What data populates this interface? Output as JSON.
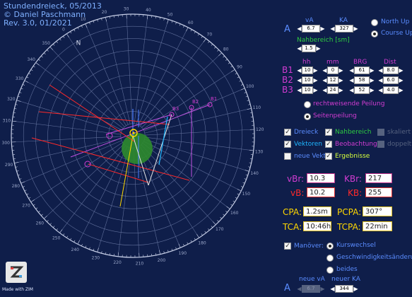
{
  "header": {
    "line1": "Stundendreieck, 05/2013",
    "line2": "© Daniel Paschmann",
    "line3": "Rev. 3.0, 01/2021"
  },
  "radar": {
    "north_label": "N",
    "bearing_labels": [
      "0",
      "10",
      "20",
      "30",
      "40",
      "50",
      "60",
      "70",
      "80",
      "90",
      "100",
      "110",
      "120",
      "130",
      "140",
      "150",
      "160",
      "170",
      "180",
      "190",
      "200",
      "210",
      "220",
      "230",
      "240",
      "250",
      "260",
      "270",
      "280",
      "290",
      "300",
      "310",
      "320",
      "330",
      "340",
      "350"
    ],
    "point_labels": [
      "B1",
      "B2",
      "B3"
    ]
  },
  "own_ship": {
    "label": "A",
    "va_label": "vA",
    "va_value": "6.7",
    "ka_label": "KA",
    "ka_value": "327",
    "north_up": "North Up",
    "course_up": "Course Up",
    "nahbereich_label": "Nahbereich [sm]",
    "nahbereich_value": "1.5"
  },
  "bearings": {
    "headers": [
      "hh",
      "mm",
      "BRG",
      "Dist"
    ],
    "rows": [
      {
        "label": "B1",
        "hh": "10",
        "mm": "0",
        "brg": "61",
        "dist": "8.0"
      },
      {
        "label": "B2",
        "hh": "10",
        "mm": "12",
        "brg": "58",
        "dist": "6.0"
      },
      {
        "label": "B3",
        "hh": "10",
        "mm": "24",
        "brg": "52",
        "dist": "4.0"
      }
    ],
    "mode1": "rechtweisende Peilung",
    "mode2": "Seitenpeilung"
  },
  "options": {
    "dreieck": "Dreieck",
    "nahbereich": "Nahbereich",
    "skaliert": "skaliert",
    "vektoren": "Vektoren",
    "beobachtung": "Beobachtung",
    "doppelt": "doppelt",
    "neue_vekt": "neue Vekt.",
    "ergebnisse": "Ergebnisse"
  },
  "results": {
    "vbr_label": "vBr:",
    "vbr_value": "10.3",
    "kbr_label": "KBr:",
    "kbr_value": "217",
    "vb_label": "vB:",
    "vb_value": "10.2",
    "kb_label": "KB:",
    "kb_value": "255",
    "cpa_label": "CPA:",
    "cpa_value": "1.2sm",
    "pcpa_label": "PCPA:",
    "pcpa_value": "307°",
    "tca_label": "TCA:",
    "tca_value": "10:46h",
    "tcpa_label": "TCPA:",
    "tcpa_value": "22min"
  },
  "maneuver": {
    "label": "Manöver:",
    "opt1": "Kurswechsel",
    "opt2": "Geschwindigkeitsänderung",
    "opt3": "beides",
    "a_label": "A",
    "neue_va_label": "neue vA",
    "neue_va_value": "6.7",
    "neuer_ka_label": "neuer KA",
    "neuer_ka_value": "344"
  },
  "footer": {
    "made_with": "Made with ZIM"
  },
  "colors": {
    "background": "#0f1e4a",
    "accent_blue": "#5a8cff",
    "magenta": "#d23cd2",
    "green": "#2ecc40",
    "yellow": "#ffd700",
    "red": "#ff2a2a",
    "cyan": "#1fb6ff"
  }
}
